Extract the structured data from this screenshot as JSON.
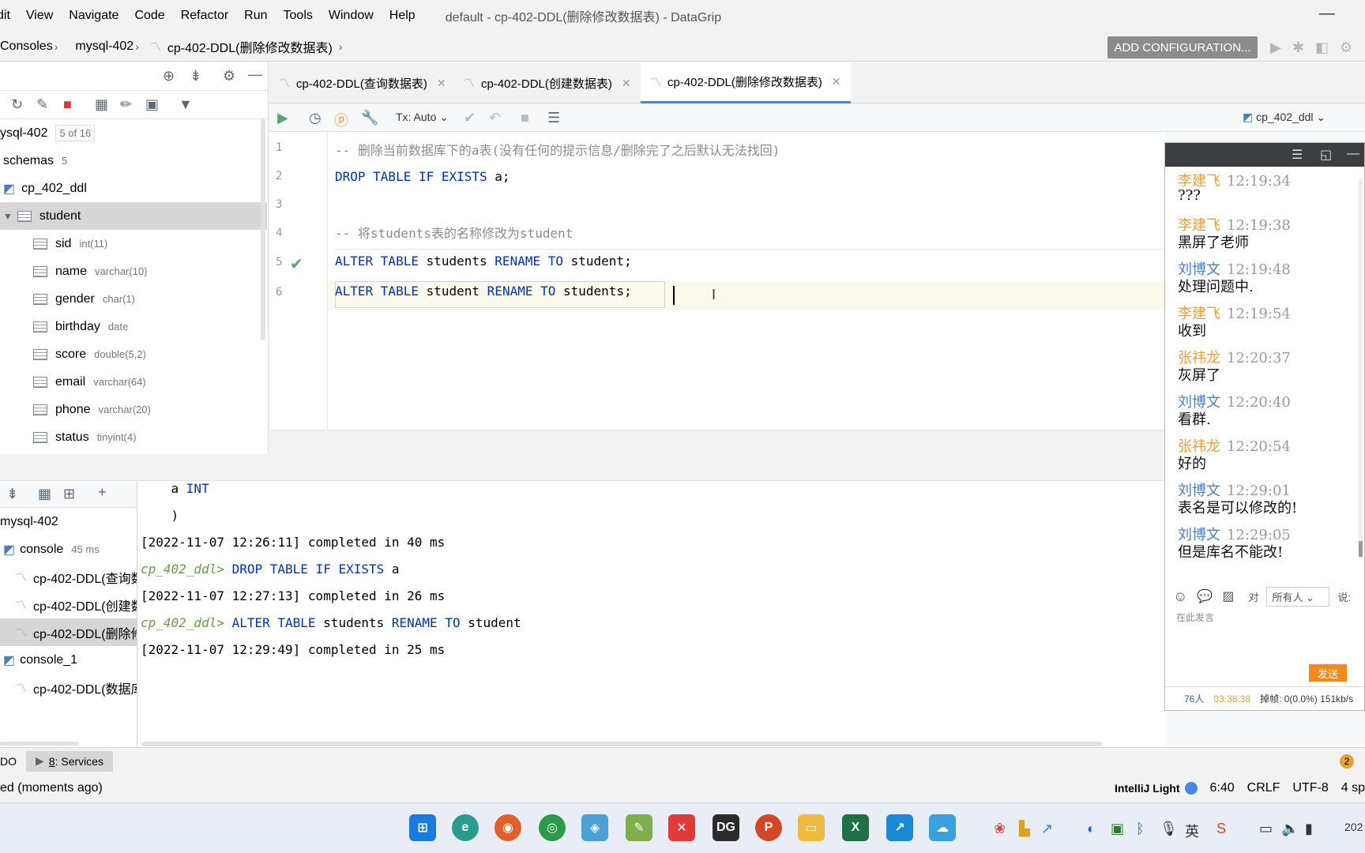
{
  "menu": [
    "dit",
    "View",
    "Navigate",
    "Code",
    "Refactor",
    "Run",
    "Tools",
    "Window",
    "Help"
  ],
  "window_title": "default - cp-402-DDL(删除修改数据表) - DataGrip",
  "breadcrumbs": [
    "Consoles",
    "mysql-402",
    "cp-402-DDL(删除修改数据表)"
  ],
  "add_config": "ADD CONFIGURATION...",
  "db_tree": {
    "root": "ysql-402",
    "root_count": "5 of 16",
    "schemas_label": "schemas",
    "schemas_count": "5",
    "schema": "cp_402_ddl",
    "table": "student",
    "columns": [
      {
        "name": "sid",
        "type": "int(11)"
      },
      {
        "name": "name",
        "type": "varchar(10)"
      },
      {
        "name": "gender",
        "type": "char(1)"
      },
      {
        "name": "birthday",
        "type": "date"
      },
      {
        "name": "score",
        "type": "double(5,2)"
      },
      {
        "name": "email",
        "type": "varchar(64)"
      },
      {
        "name": "phone",
        "type": "varchar(20)"
      },
      {
        "name": "status",
        "type": "tinyint(4)"
      }
    ]
  },
  "tabs": [
    {
      "label": "cp-402-DDL(查询数据表)"
    },
    {
      "label": "cp-402-DDL(创建数据表)"
    },
    {
      "label": "cp-402-DDL(删除修改数据表)"
    }
  ],
  "editor_toolbar": {
    "tx": "Tx: Auto",
    "schema": "cp_402_ddl"
  },
  "editor": {
    "line_numbers": [
      "1",
      "2",
      "3",
      "4",
      "5",
      "6"
    ],
    "line1": "-- 删除当前数据库下的a表(没有任何的提示信息/删除完了之后默认无法找回)",
    "line2_kw": "DROP TABLE IF EXISTS",
    "line2_rest": " a;",
    "line4": "-- 将students表的名称修改为student",
    "line5_kw1": "ALTER TABLE",
    "line5_mid": " students ",
    "line5_kw2": "RENAME TO",
    "line5_rest": " student;",
    "line6_kw1": "ALTER TABLE",
    "line6_mid": " student ",
    "line6_kw2": "RENAME TO",
    "line6_rest": " students;"
  },
  "services": {
    "root": "mysql-402",
    "console": "console",
    "console_time": "45 ms",
    "items": [
      "cp-402-DDL(查询数",
      "cp-402-DDL(创建数",
      "cp-402-DDL(删除修"
    ],
    "console_1": "console_1",
    "console_1_item": "cp-402-DDL(数据库"
  },
  "output": {
    "l1_indent": "    a ",
    "l1_kw": "INT",
    "l2": "    )",
    "l3": "[2022-11-07 12:26:11] completed in 40 ms",
    "l4_prompt": "cp_402_ddl>",
    "l4_kw": " DROP TABLE IF EXISTS",
    "l4_rest": " a",
    "l5": "[2022-11-07 12:27:13] completed in 26 ms",
    "l6_prompt": "cp_402_ddl>",
    "l6_kw1": " ALTER TABLE",
    "l6_mid": " students ",
    "l6_kw2": "RENAME TO",
    "l6_rest": " student",
    "l7": "[2022-11-07 12:29:49] completed in 25 ms"
  },
  "chat": {
    "messages": [
      {
        "name": "李建飞",
        "time": "12:19:34",
        "text": "???",
        "color": "#e8a03a"
      },
      {
        "name": "李建飞",
        "time": "12:19:38",
        "text": "黑屏了老师",
        "color": "#e8a03a"
      },
      {
        "name": "刘博文",
        "time": "12:19:48",
        "text": "处理问题中.",
        "color": "#4a7fc4"
      },
      {
        "name": "李建飞",
        "time": "12:19:54",
        "text": "收到",
        "color": "#e8a03a"
      },
      {
        "name": "张祎龙",
        "time": "12:20:37",
        "text": "灰屏了",
        "color": "#e8a03a"
      },
      {
        "name": "刘博文",
        "time": "12:20:40",
        "text": "看群.",
        "color": "#4a7fc4"
      },
      {
        "name": "张祎龙",
        "time": "12:20:54",
        "text": "好的",
        "color": "#e8a03a"
      },
      {
        "name": "刘博文",
        "time": "12:29:01",
        "text": "表名是可以修改的!",
        "color": "#4a7fc4"
      },
      {
        "name": "刘博文",
        "time": "12:29:05",
        "text": "但是库名不能改!",
        "color": "#4a7fc4"
      }
    ],
    "to_label": "对",
    "to_value": "所有人",
    "say_label": "说:",
    "placeholder": "在此发言",
    "send": "发送",
    "people": "76人",
    "duration": "03:38:38",
    "stats": "掉帧: 0(0.0%) 151kb/s"
  },
  "tool_tabs": {
    "todo": "DO",
    "services_num": "8",
    "services_label": ": Services"
  },
  "status": {
    "left": "ed (moments ago)",
    "theme": "IntelliJ Light",
    "pos": "6:40",
    "crlf": "CRLF",
    "enc": "UTF-8",
    "indent": "4 sp",
    "badge": "2"
  },
  "taskbar": {
    "clock": "202"
  }
}
